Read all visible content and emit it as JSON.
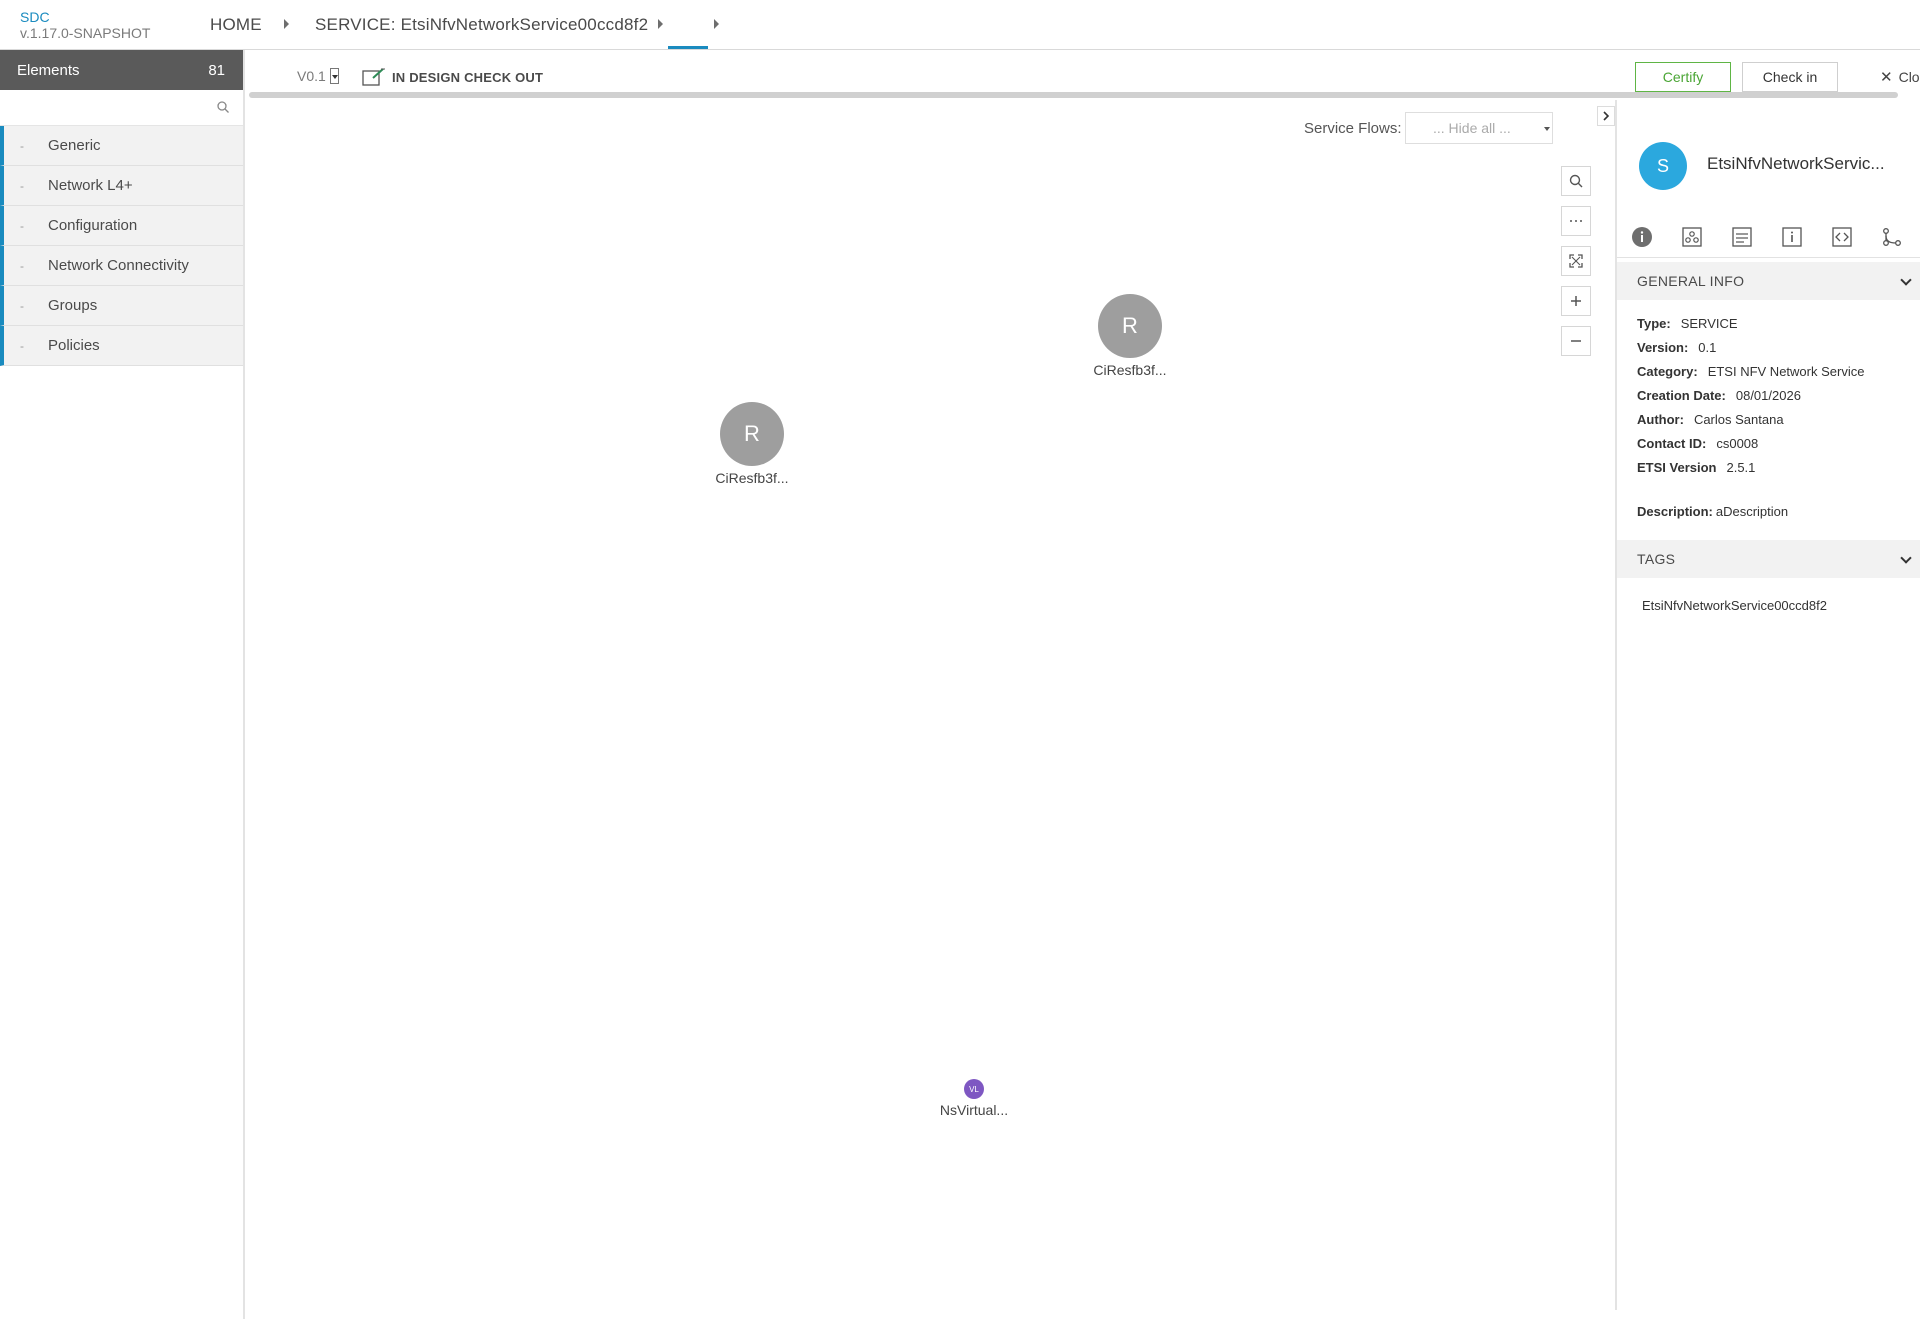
{
  "header": {
    "brand": "SDC",
    "version": "v.1.17.0-SNAPSHOT",
    "breadcrumbs": [
      "HOME",
      "SERVICE: EtsiNfvNetworkService00ccd8f2"
    ]
  },
  "palette": {
    "title": "Elements",
    "count": "81",
    "search_placeholder": "",
    "categories": [
      {
        "dash": "-",
        "label": "Generic"
      },
      {
        "dash": "-",
        "label": "Network L4+"
      },
      {
        "dash": "-",
        "label": "Configuration"
      },
      {
        "dash": "-",
        "label": "Network Connectivity"
      },
      {
        "dash": "-",
        "label": "Groups"
      },
      {
        "dash": "-",
        "label": "Policies"
      }
    ]
  },
  "toolbar": {
    "version": "V0.1",
    "status": "IN DESIGN CHECK OUT",
    "certify_label": "Certify",
    "checkin_label": "Check in",
    "close_label": "Close"
  },
  "canvas": {
    "service_flows_label": "Service Flows:",
    "service_flows_value": "... Hide all ...",
    "zoom_tools": [
      "search-icon",
      "more-icon",
      "fit-icon",
      "zoom-in-icon",
      "zoom-out-icon"
    ],
    "nodes": [
      {
        "initial": "R",
        "label": "CiResfb3f..."
      },
      {
        "initial": "R",
        "label": "CiResfb3f..."
      },
      {
        "initial": "VL",
        "label": "NsVirtual..."
      }
    ]
  },
  "info_panel": {
    "avatar_initial": "S",
    "name": "EtsiNfvNetworkServic...",
    "tabs": [
      "info-icon",
      "composition-icon",
      "deployment-icon",
      "properties-icon",
      "api-icon",
      "paths-icon"
    ],
    "general_info_title": "GENERAL INFO",
    "fields": [
      {
        "key": "Type:",
        "value": "SERVICE"
      },
      {
        "key": "Version:",
        "value": "0.1"
      },
      {
        "key": "Category:",
        "value": "ETSI NFV Network Service"
      },
      {
        "key": "Creation Date:",
        "value": "08/01/2026"
      },
      {
        "key": "Author:",
        "value": "Carlos Santana"
      },
      {
        "key": "Contact ID:",
        "value": "cs0008"
      },
      {
        "key": "ETSI Version",
        "value": "2.5.1"
      }
    ],
    "description_key": "Description:",
    "description_value": "aDescription",
    "tags_title": "TAGS",
    "tags": [
      "EtsiNfvNetworkService00ccd8f2"
    ]
  },
  "colors": {
    "accent": "#1a8bbf",
    "avatar": "#2ba8de",
    "node_gray": "#9e9e9e",
    "virtual_link": "#7e57c2",
    "certify_green": "#4aa534",
    "palette_header": "#5a5a5a"
  }
}
